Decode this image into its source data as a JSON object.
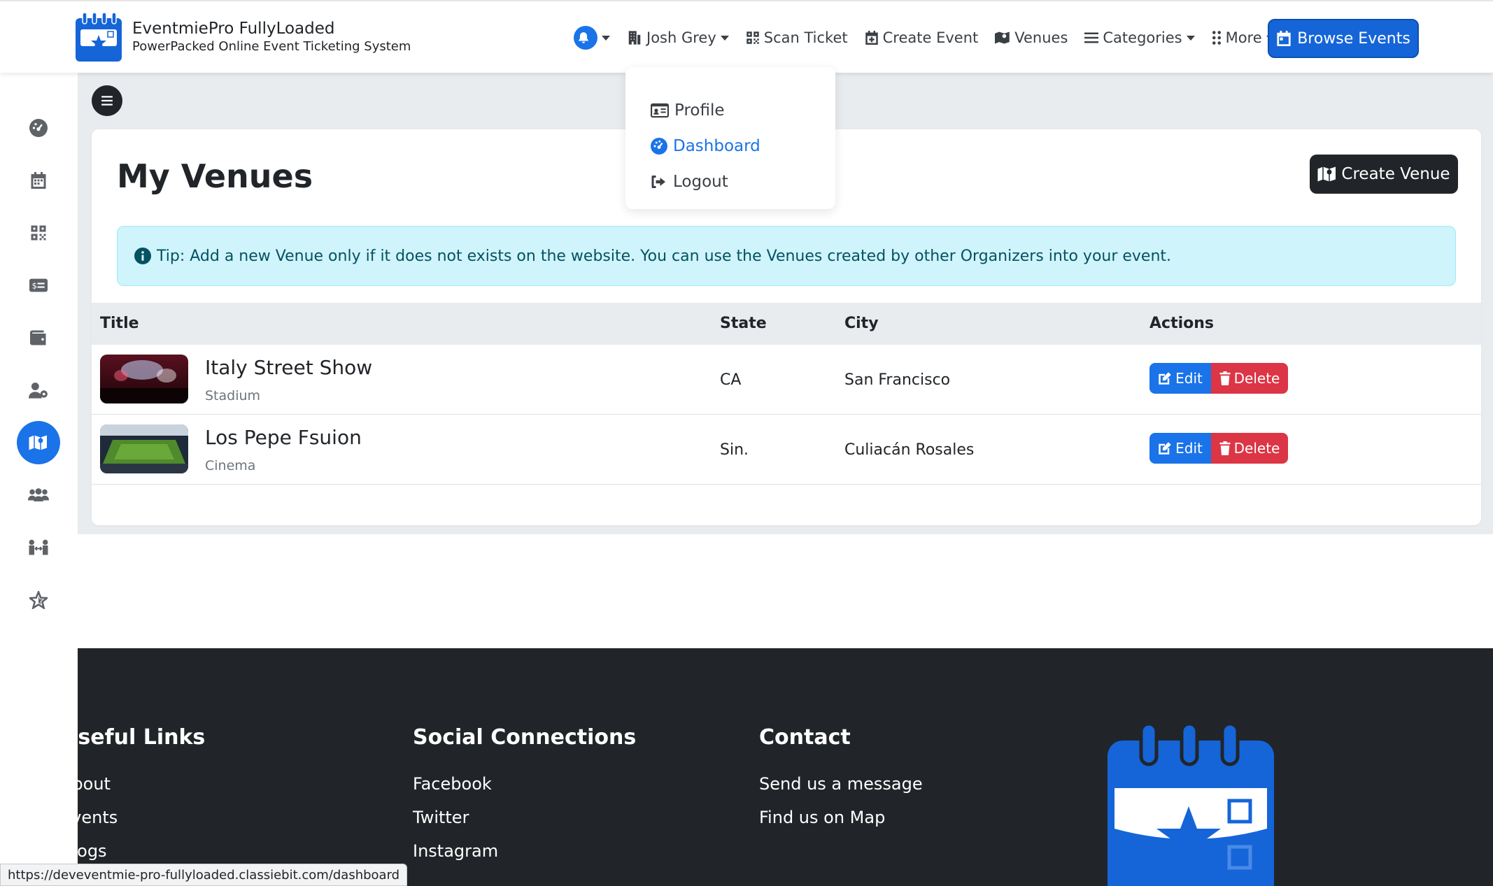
{
  "brand": {
    "name": "EventmiePro FullyLoaded",
    "tagline": "PowerPacked Online Event Ticketing System"
  },
  "nav": {
    "user": "Josh Grey",
    "scan_ticket": "Scan Ticket",
    "create_event": "Create Event",
    "venues": "Venues",
    "categories": "Categories",
    "more": "More",
    "browse_events": "Browse Events"
  },
  "user_menu": {
    "items": [
      {
        "label": "Profile",
        "icon": "id-card-icon"
      },
      {
        "label": "Dashboard",
        "icon": "gauge-icon",
        "active": true
      },
      {
        "label": "Logout",
        "icon": "logout-icon"
      }
    ]
  },
  "sidebar": {
    "items": [
      {
        "icon": "gauge-icon"
      },
      {
        "icon": "calendar-icon"
      },
      {
        "icon": "qrcode-icon"
      },
      {
        "icon": "money-card-icon"
      },
      {
        "icon": "wallet-icon"
      },
      {
        "icon": "user-gear-icon"
      },
      {
        "icon": "map-icon",
        "active": true
      },
      {
        "icon": "people-group-icon"
      },
      {
        "icon": "people-arrows-icon"
      },
      {
        "icon": "star-icon"
      }
    ]
  },
  "page": {
    "title": "My Venues",
    "create_button": "Create Venue",
    "tip": "Tip: Add a new Venue only if it does not exists on the website. You can use the Venues created by other Organizers into your event."
  },
  "table": {
    "columns": [
      "Title",
      "State",
      "City",
      "Actions"
    ],
    "rows": [
      {
        "title": "Italy Street Show",
        "type": "Stadium",
        "state": "CA",
        "city": "San Francisco"
      },
      {
        "title": "Los Pepe Fsuion",
        "type": "Cinema",
        "state": "Sin.",
        "city": "Culiacán Rosales"
      }
    ],
    "edit_label": "Edit",
    "delete_label": "Delete"
  },
  "footer": {
    "useful_links": {
      "title": "Useful Links",
      "links": [
        "About",
        "Events",
        "Blogs"
      ]
    },
    "social": {
      "title": "Social Connections",
      "links": [
        "Facebook",
        "Twitter",
        "Instagram"
      ]
    },
    "contact": {
      "title": "Contact",
      "links": [
        "Send us a message",
        "Find us on Map"
      ]
    }
  },
  "status_url": "https://deveventmie-pro-fullyloaded.classiebit.com/dashboard",
  "colors": {
    "primary": "#1a73e8",
    "danger": "#dc3545",
    "dark": "#212529",
    "info_bg": "#cff4fc"
  }
}
